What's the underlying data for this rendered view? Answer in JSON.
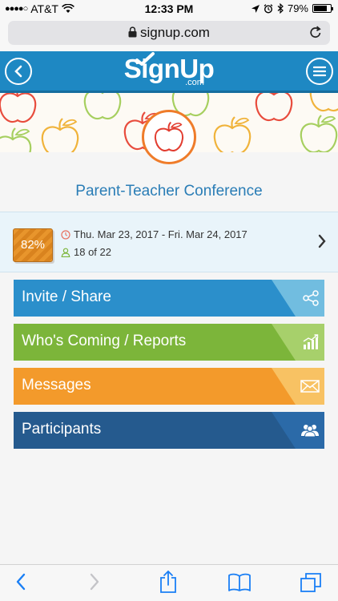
{
  "status_bar": {
    "carrier": "AT&T",
    "time": "12:33 PM",
    "battery": "79%",
    "battery_level": 0.79
  },
  "browser": {
    "url": "signup.com"
  },
  "app": {
    "logo_text": "SignUp",
    "logo_sub": ".com",
    "brand_color": "#1e88c3"
  },
  "event": {
    "title": "Parent-Teacher Conference",
    "percent": "82%",
    "date_range": "Thu. Mar 23, 2017 - Fri. Mar 24, 2017",
    "count": "18 of 22"
  },
  "menu": [
    {
      "label": "Invite / Share",
      "icon": "share-icon",
      "color": "#2b8fcb"
    },
    {
      "label": "Who's Coming / Reports",
      "icon": "reports-chart-icon",
      "color": "#7cb53a"
    },
    {
      "label": "Messages",
      "icon": "envelope-icon",
      "color": "#f39a2b"
    },
    {
      "label": "Participants",
      "icon": "group-icon",
      "color": "#255a8e"
    }
  ],
  "toolbar_icons": [
    "back-arrow-icon",
    "forward-arrow-icon",
    "share-icon",
    "bookmarks-icon",
    "tabs-icon"
  ]
}
